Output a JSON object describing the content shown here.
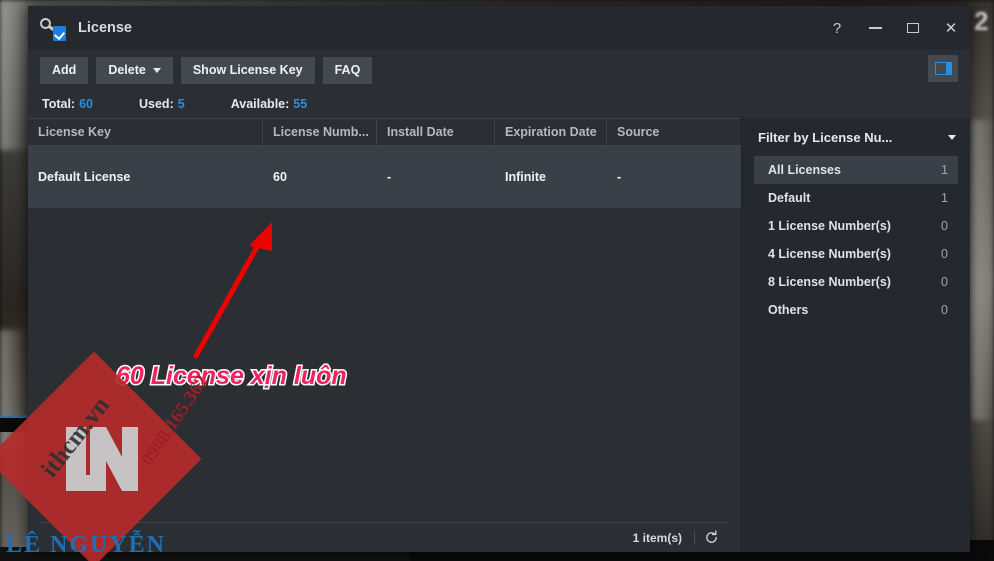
{
  "window": {
    "title": "License",
    "app_icon": "key-check-icon",
    "controls": [
      {
        "name": "help-button",
        "glyph": "?"
      },
      {
        "name": "minimize-button",
        "glyph": ""
      },
      {
        "name": "maximize-button",
        "glyph": ""
      },
      {
        "name": "close-button",
        "glyph": "✕"
      }
    ]
  },
  "toolbar": {
    "add_label": "Add",
    "delete_label": "Delete",
    "show_license_key_label": "Show License Key",
    "faq_label": "FAQ",
    "panel_toggle_icon": "panel-layout-icon"
  },
  "stats": [
    {
      "label": "Total:",
      "value": "60"
    },
    {
      "label": "Used:",
      "value": "5"
    },
    {
      "label": "Available:",
      "value": "55"
    }
  ],
  "table": {
    "columns": [
      "License Key",
      "License Numb...",
      "Install Date",
      "Expiration Date",
      "Source"
    ],
    "rows": [
      {
        "license_key": "Default License",
        "license_number": "60",
        "install_date": "-",
        "expiration_date": "Infinite",
        "source": "-"
      }
    ]
  },
  "statusbar": {
    "item_count": "1 item(s)",
    "refresh_icon": "refresh-icon"
  },
  "filter_panel": {
    "title": "Filter by License Nu...",
    "caret_icon": "chevron-down-icon",
    "items": [
      {
        "label": "All Licenses",
        "count": "1",
        "selected": true
      },
      {
        "label": "Default",
        "count": "1",
        "selected": false
      },
      {
        "label": "1 License Number(s)",
        "count": "0",
        "selected": false
      },
      {
        "label": "4 License Number(s)",
        "count": "0",
        "selected": false
      },
      {
        "label": "8 License Number(s)",
        "count": "0",
        "selected": false
      },
      {
        "label": "Others",
        "count": "0",
        "selected": false
      }
    ]
  },
  "annotation": {
    "text": "60 License xịn luôn",
    "arrow_color": "#ee0000",
    "text_color": "#f0225f"
  },
  "watermark": {
    "brand": "LÊ NGUYỄN",
    "site": "ithcm.vn",
    "phone": "0908.165.362",
    "monogram": "LN"
  },
  "desktop": {
    "number": "2"
  },
  "colors": {
    "accent_blue": "#2a8fe0",
    "window_bg": "#2b2f33",
    "titlebar_bg": "#25282c",
    "row_selected": "#3a4048"
  }
}
